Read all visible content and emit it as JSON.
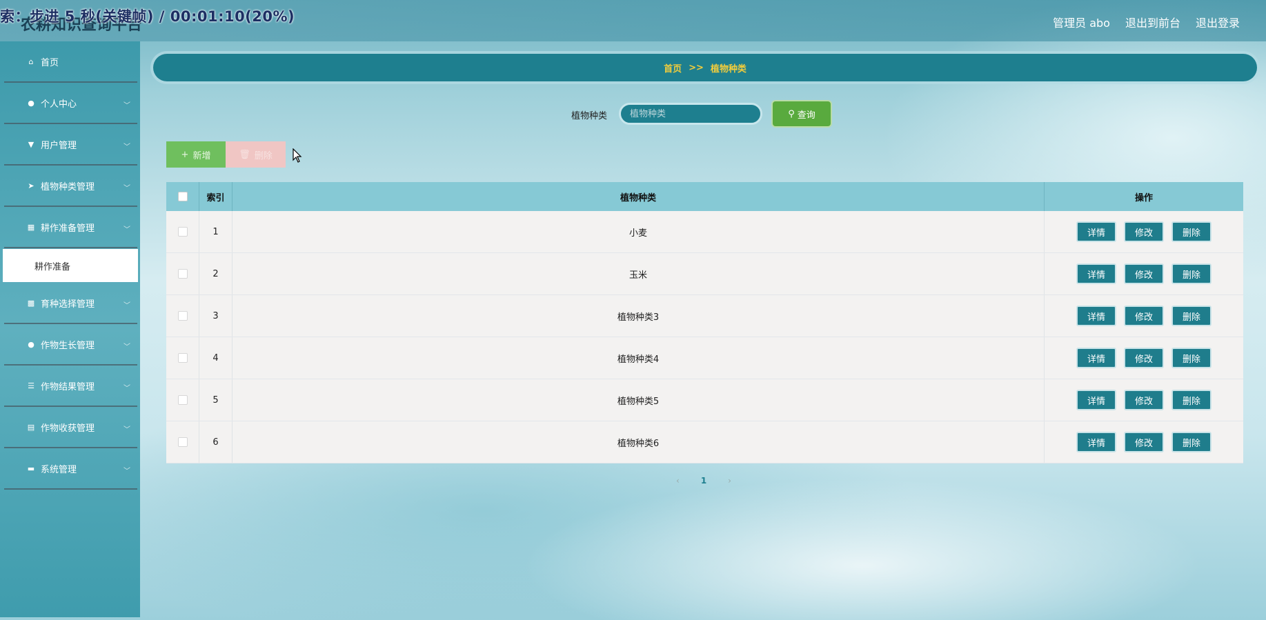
{
  "overlay": {
    "caption": "索：步进 5 秒(关键帧) / 00:01:10(20%)"
  },
  "app": {
    "title": "农耕知识查询平台"
  },
  "topnav": {
    "user": "管理员 abo",
    "front": "退出到前台",
    "logout": "退出登录"
  },
  "sidebar": {
    "items": [
      {
        "label": "首页",
        "icon": "home-icon",
        "has_chevron": false
      },
      {
        "label": "个人中心",
        "icon": "user-icon",
        "has_chevron": true
      },
      {
        "label": "用户管理",
        "icon": "user-manage-icon",
        "has_chevron": true
      },
      {
        "label": "植物种类管理",
        "icon": "send-icon",
        "has_chevron": true
      },
      {
        "label": "耕作准备管理",
        "icon": "grid-icon",
        "has_chevron": true
      },
      {
        "label": "育种选择管理",
        "icon": "apps-icon",
        "has_chevron": true
      },
      {
        "label": "作物生长管理",
        "icon": "person-icon",
        "has_chevron": true
      },
      {
        "label": "作物结果管理",
        "icon": "sliders-icon",
        "has_chevron": true
      },
      {
        "label": "作物收获管理",
        "icon": "clipboard-icon",
        "has_chevron": true
      },
      {
        "label": "系统管理",
        "icon": "briefcase-icon",
        "has_chevron": true
      }
    ],
    "submenu": {
      "label": "耕作准备"
    }
  },
  "breadcrumb": {
    "home": "首页",
    "sep": ">>",
    "current": "植物种类"
  },
  "search": {
    "label": "植物种类",
    "placeholder": "植物种类",
    "button": "查询"
  },
  "actions": {
    "add": "新增",
    "delete": "删除"
  },
  "table": {
    "headers": {
      "index": "索引",
      "name": "植物种类",
      "ops": "操作"
    },
    "rows": [
      {
        "index": "1",
        "name": "小麦"
      },
      {
        "index": "2",
        "name": "玉米"
      },
      {
        "index": "3",
        "name": "植物种类3"
      },
      {
        "index": "4",
        "name": "植物种类4"
      },
      {
        "index": "5",
        "name": "植物种类5"
      },
      {
        "index": "6",
        "name": "植物种类6"
      }
    ],
    "row_buttons": {
      "detail": "详情",
      "edit": "修改",
      "delete": "删除"
    }
  },
  "pagination": {
    "prev": "‹",
    "current": "1",
    "next": "›"
  },
  "colors": {
    "teal": "#1e7f8f",
    "header": "#86c9d5",
    "green": "#59aa3e",
    "gold": "#f2cd3c"
  }
}
